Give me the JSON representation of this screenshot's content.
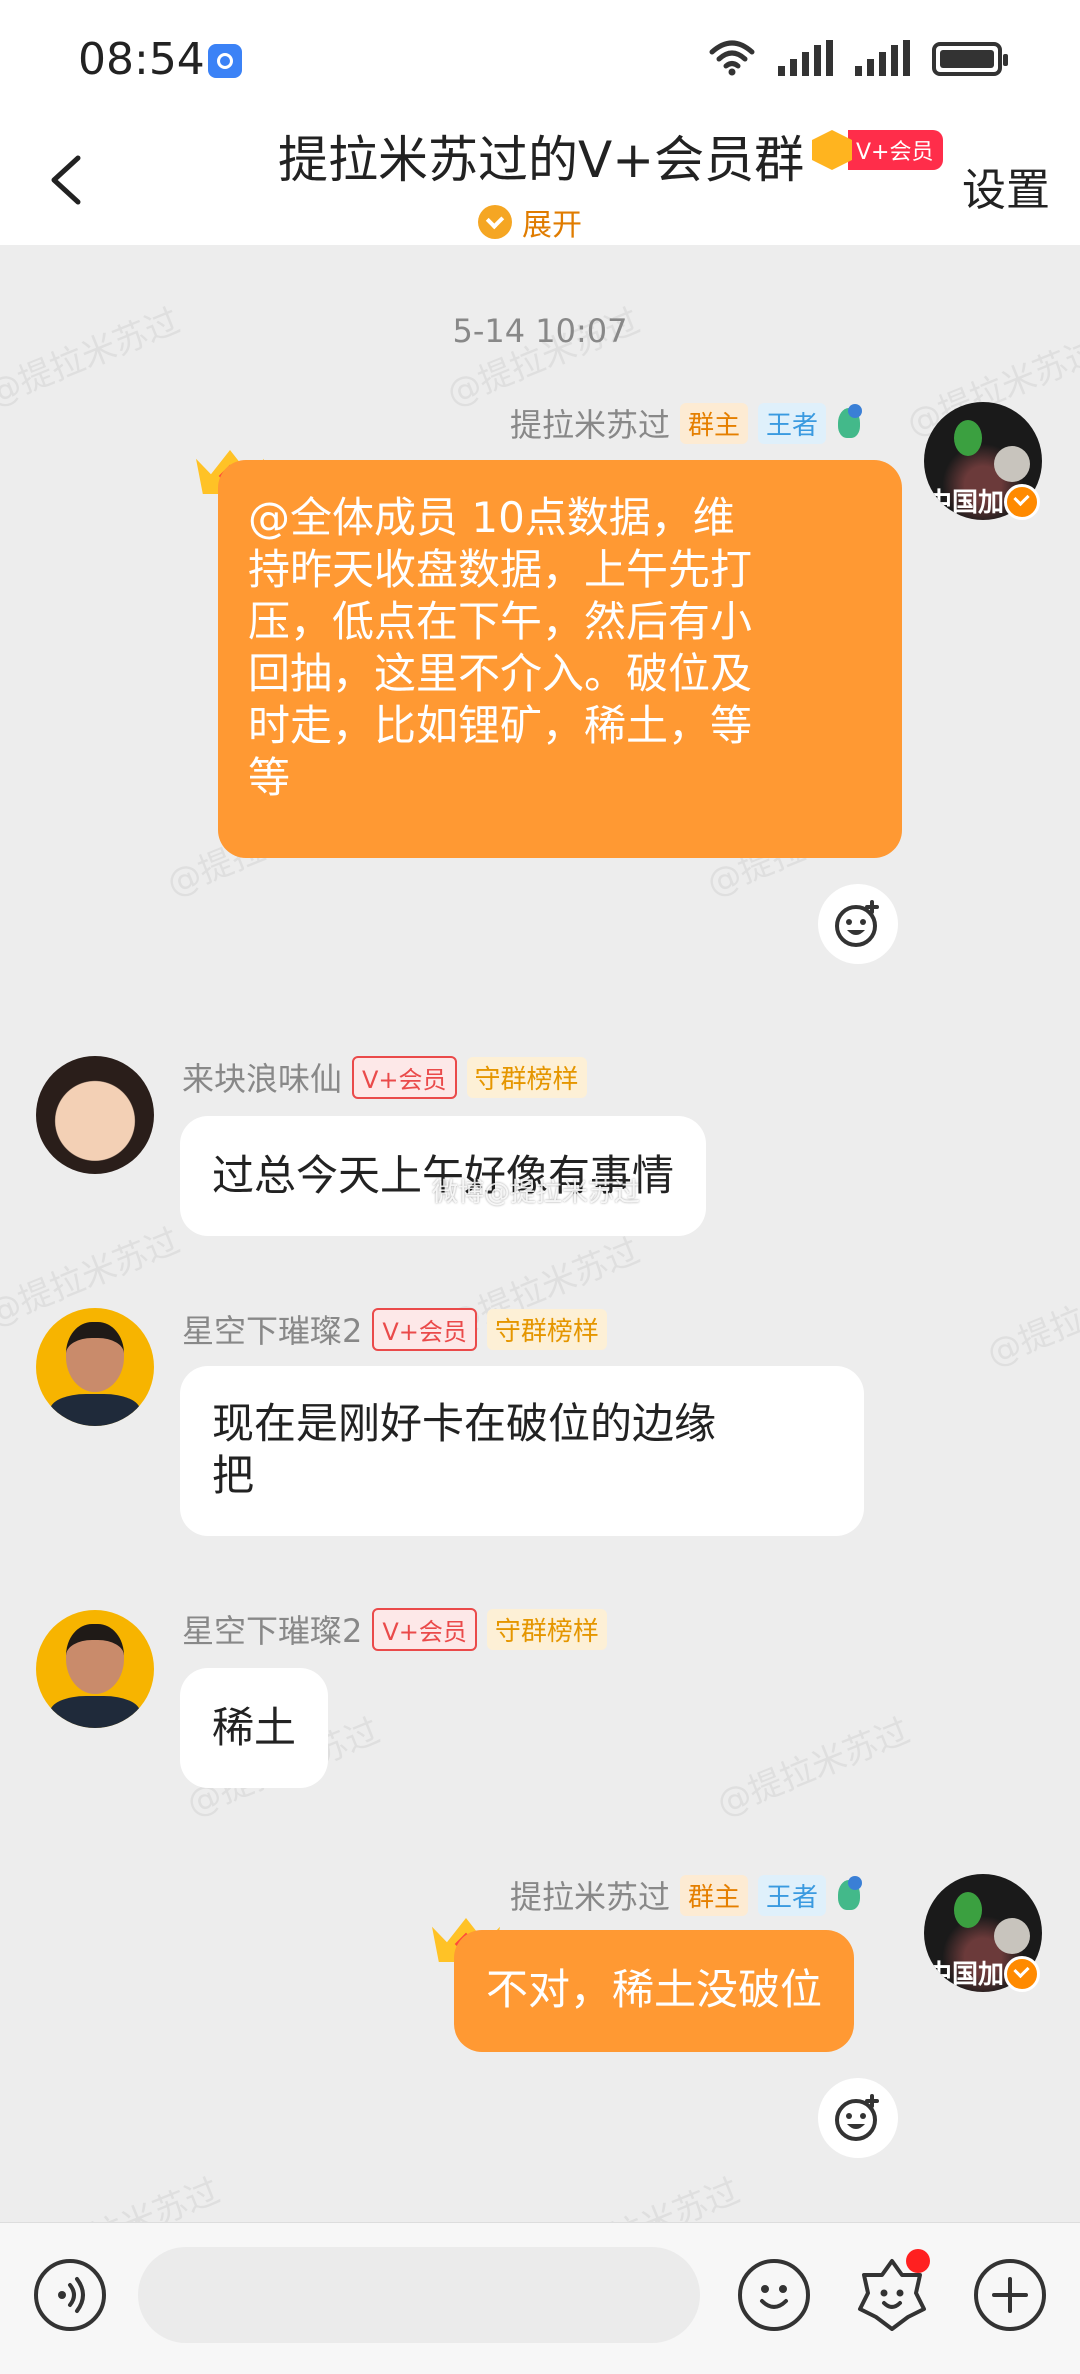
{
  "status_bar": {
    "time": "08:54"
  },
  "header": {
    "title": "提拉米苏过的V+会员群",
    "vip_badge": "V+会员",
    "expand_label": "展开",
    "settings_label": "设置"
  },
  "chat": {
    "timestamp": "5-14 10:07",
    "messages": [
      {
        "sender": "提拉米苏过",
        "tags": [
          "群主",
          "王者"
        ],
        "avatar_text": "中国加",
        "text": "@全体成员 10点数据，维持昨天收盘数据，上午先打压，低点在下午，然后有小回抽，这里不介入。破位及时走，比如锂矿，稀土，等等",
        "lines": [
          "@全体成员 10点数据，维",
          "持昨天收盘数据，上午先打",
          "压，低点在下午，然后有小",
          "回抽，这里不介入。破位及",
          "时走，比如锂矿，稀土，等",
          "等"
        ]
      },
      {
        "sender": "来块浪味仙",
        "tags": [
          "V+会员",
          "守群榜样"
        ],
        "text": "过总今天上午好像有事情"
      },
      {
        "sender": "星空下璀璨2",
        "tags": [
          "V+会员",
          "守群榜样"
        ],
        "lines": [
          "现在是刚好卡在破位的边缘",
          "把"
        ]
      },
      {
        "sender": "星空下璀璨2",
        "tags": [
          "V+会员",
          "守群榜样"
        ],
        "text": "稀土"
      },
      {
        "sender": "提拉米苏过",
        "tags": [
          "群主",
          "王者"
        ],
        "avatar_text": "中国加",
        "text": "不对，稀土没破位"
      }
    ]
  },
  "watermark_text": "@提拉米苏过",
  "overlay_watermark": "微博@提拉米苏过",
  "colors": {
    "accent": "#ff9933",
    "background": "#ededed",
    "vip_red": "#ff2d4a"
  },
  "icons": [
    "back-arrow-icon",
    "voice-icon",
    "emoji-icon",
    "sticker-icon",
    "plus-icon",
    "reaction-icon",
    "crown-icon",
    "wifi-icon",
    "signal-icon",
    "battery-icon"
  ]
}
